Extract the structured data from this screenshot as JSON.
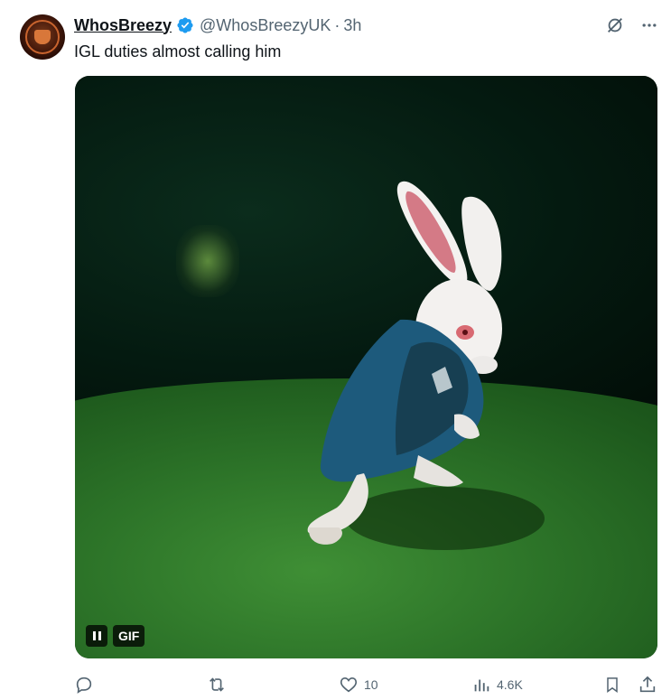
{
  "tweet": {
    "author_name": "WhosBreezy",
    "handle": "@WhosBreezyUK",
    "separator": "·",
    "time": "3h",
    "text": "IGL duties almost calling him",
    "media_label": "GIF"
  },
  "actions": {
    "likes": "10",
    "views": "4.6K"
  },
  "colors": {
    "verified": "#1d9bf0",
    "muted": "#536471",
    "text": "#0f1419"
  },
  "icons": [
    "grok-icon",
    "more-icon",
    "reply-icon",
    "retweet-icon",
    "like-icon",
    "views-icon",
    "bookmark-icon",
    "share-icon",
    "pause-icon",
    "verified-badge-icon"
  ]
}
